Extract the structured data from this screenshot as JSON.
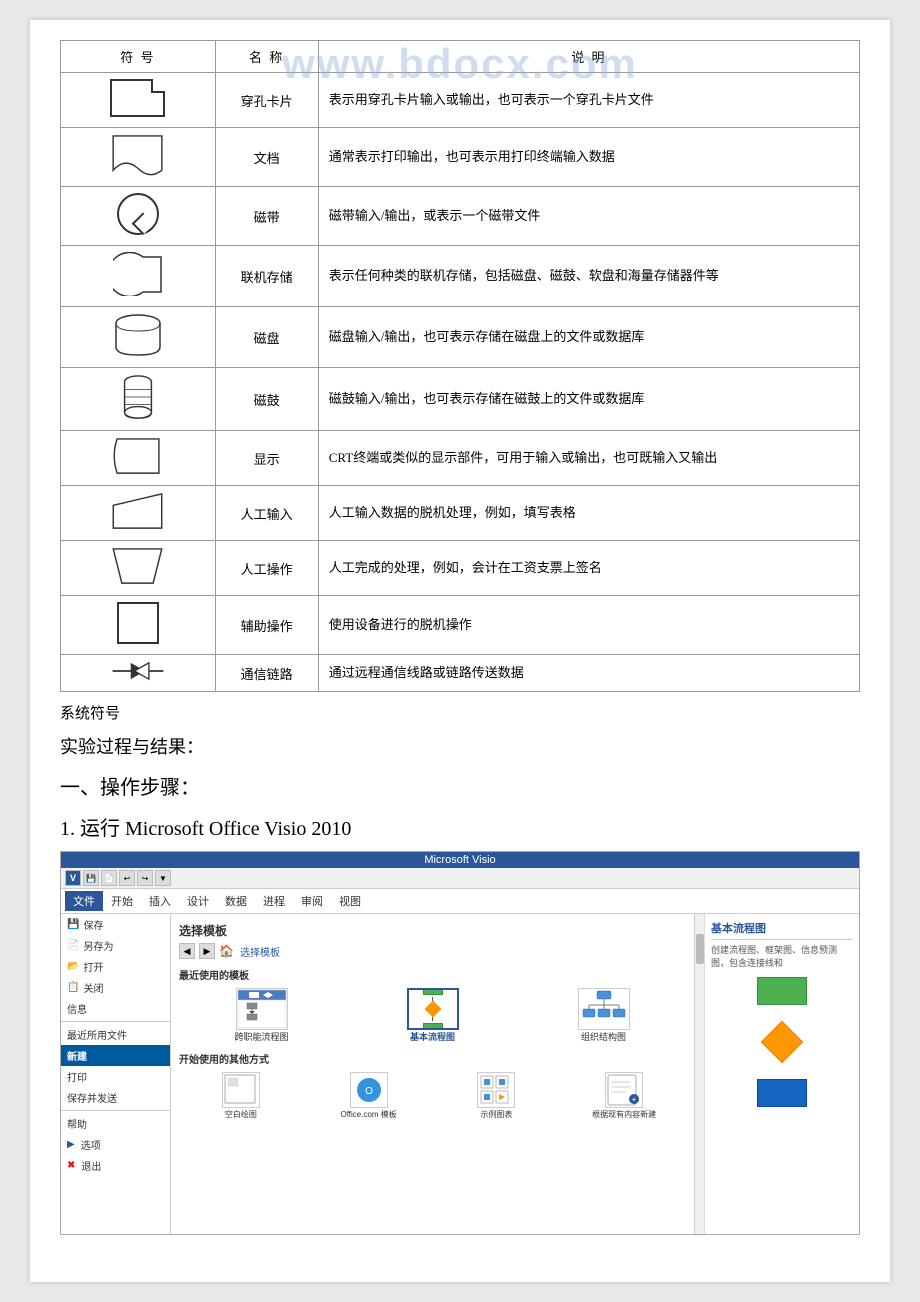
{
  "page": {
    "background": "#e8e8e8"
  },
  "table": {
    "headers": [
      "符 号",
      "名 称",
      "说 明"
    ],
    "rows": [
      {
        "symbol_type": "punched-card",
        "name": "穿孔卡片",
        "description": "表示用穿孔卡片输入或输出，也可表示一个穿孔卡片文件"
      },
      {
        "symbol_type": "document",
        "name": "文档",
        "description": "通常表示打印输出，也可表示用打印终端输入数据"
      },
      {
        "symbol_type": "magnetic-tape",
        "name": "磁带",
        "description": "磁带输入/输出，或表示一个磁带文件"
      },
      {
        "symbol_type": "online-storage",
        "name": "联机存储",
        "description": "表示任何种类的联机存储，包括磁盘、磁鼓、软盘和海量存储器件等"
      },
      {
        "symbol_type": "disk",
        "name": "磁盘",
        "description": "磁盘输入/输出，也可表示存储在磁盘上的文件或数据库"
      },
      {
        "symbol_type": "drum",
        "name": "磁鼓",
        "description": "磁鼓输入/输出，也可表示存储在磁鼓上的文件或数据库"
      },
      {
        "symbol_type": "display",
        "name": "显示",
        "description": "CRT终端或类似的显示部件，可用于输入或输出，也可既输入又输出"
      },
      {
        "symbol_type": "manual-input",
        "name": "人工输入",
        "description": "人工输入数据的脱机处理，例如，填写表格"
      },
      {
        "symbol_type": "manual-op",
        "name": "人工操作",
        "description": "人工完成的处理，例如，会计在工资支票上签名"
      },
      {
        "symbol_type": "auxiliary",
        "name": "辅助操作",
        "description": "使用设备进行的脱机操作"
      },
      {
        "symbol_type": "communication",
        "name": "通信链路",
        "description": "通过远程通信线路或链路传送数据"
      }
    ]
  },
  "watermark": "www.bdocx.com",
  "section_system": "系统符号",
  "section_experiment": "实验过程与结果：",
  "section_ops": "一、操作步骤：",
  "section_step1": "1.   运行 Microsoft Office Visio 2010",
  "visio": {
    "title": "Microsoft Visio",
    "toolbar_icons": [
      "save",
      "save-as",
      "undo",
      "redo",
      "customize"
    ],
    "menu_items": [
      "文件",
      "开始",
      "插入",
      "设计",
      "数据",
      "进程",
      "审阅",
      "视图"
    ],
    "active_tab": "文件",
    "left_panel": {
      "items": [
        {
          "label": "保存",
          "icon": "save",
          "indent": false
        },
        {
          "label": "另存为",
          "icon": "save-as",
          "indent": false
        },
        {
          "label": "打开",
          "icon": "open",
          "indent": false
        },
        {
          "label": "关闭",
          "icon": "close",
          "indent": false
        },
        {
          "label": "信息",
          "icon": "info",
          "indent": false
        },
        {
          "label": "最近所用文件",
          "icon": "recent",
          "indent": false
        },
        {
          "label": "新建",
          "icon": "new",
          "highlight": true,
          "indent": false
        },
        {
          "label": "打印",
          "icon": "print",
          "indent": false
        },
        {
          "label": "保存并发送",
          "icon": "send",
          "indent": false
        },
        {
          "label": "帮助",
          "icon": "help",
          "indent": false
        },
        {
          "label": "选项",
          "icon": "options",
          "indent": false
        },
        {
          "label": "退出",
          "icon": "exit",
          "indent": false
        }
      ]
    },
    "main_area": {
      "select_template_label": "选择模板",
      "recent_label": "最近使用的模板",
      "templates": [
        {
          "label": "跨职能流程图",
          "selected": false
        },
        {
          "label": "基本流程图",
          "selected": true
        },
        {
          "label": "组织结构图",
          "selected": false
        }
      ],
      "other_methods_label": "开始使用的其他方式",
      "other_methods": [
        {
          "label": "空白绘图"
        },
        {
          "label": "Office.com 模板"
        },
        {
          "label": "示例图表"
        },
        {
          "label": "根据现有内容新建"
        }
      ]
    },
    "right_panel": {
      "title": "基本流程图",
      "description": "创建流程图、框架图、信息预测图，包含连接线和"
    }
  }
}
